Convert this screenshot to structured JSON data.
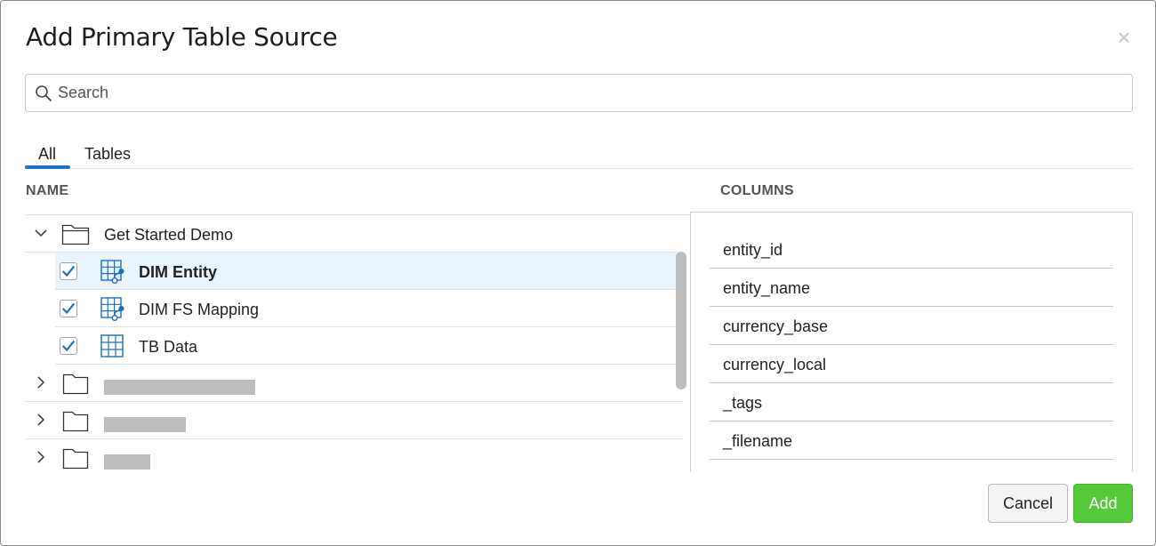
{
  "dialog": {
    "title": "Add Primary Table Source",
    "close_glyph": "×"
  },
  "search": {
    "placeholder": "Search",
    "value": "",
    "icon": "search-icon"
  },
  "tabs": [
    {
      "label": "All",
      "active": true
    },
    {
      "label": "Tables",
      "active": false
    }
  ],
  "headers": {
    "name": "NAME",
    "columns": "COLUMNS"
  },
  "tree": {
    "folder": {
      "label": "Get Started Demo",
      "expanded": true
    },
    "items": [
      {
        "label": "DIM Entity",
        "checked": true,
        "selected": true,
        "icon": "linked-table-icon"
      },
      {
        "label": "DIM FS Mapping",
        "checked": true,
        "selected": false,
        "icon": "linked-table-icon"
      },
      {
        "label": "TB Data",
        "checked": true,
        "selected": false,
        "icon": "table-icon"
      }
    ],
    "collapsed_folders": [
      {
        "label": "",
        "redacted": true
      },
      {
        "label": "",
        "redacted": true
      },
      {
        "label": "",
        "redacted": true
      }
    ]
  },
  "columns": [
    "entity_id",
    "entity_name",
    "currency_base",
    "currency_local",
    "_tags",
    "_filename"
  ],
  "buttons": {
    "cancel": "Cancel",
    "add": "Add"
  },
  "colors": {
    "accent": "#1a73c9",
    "add_button": "#54c93a",
    "selected_row": "#eaf4fd"
  }
}
